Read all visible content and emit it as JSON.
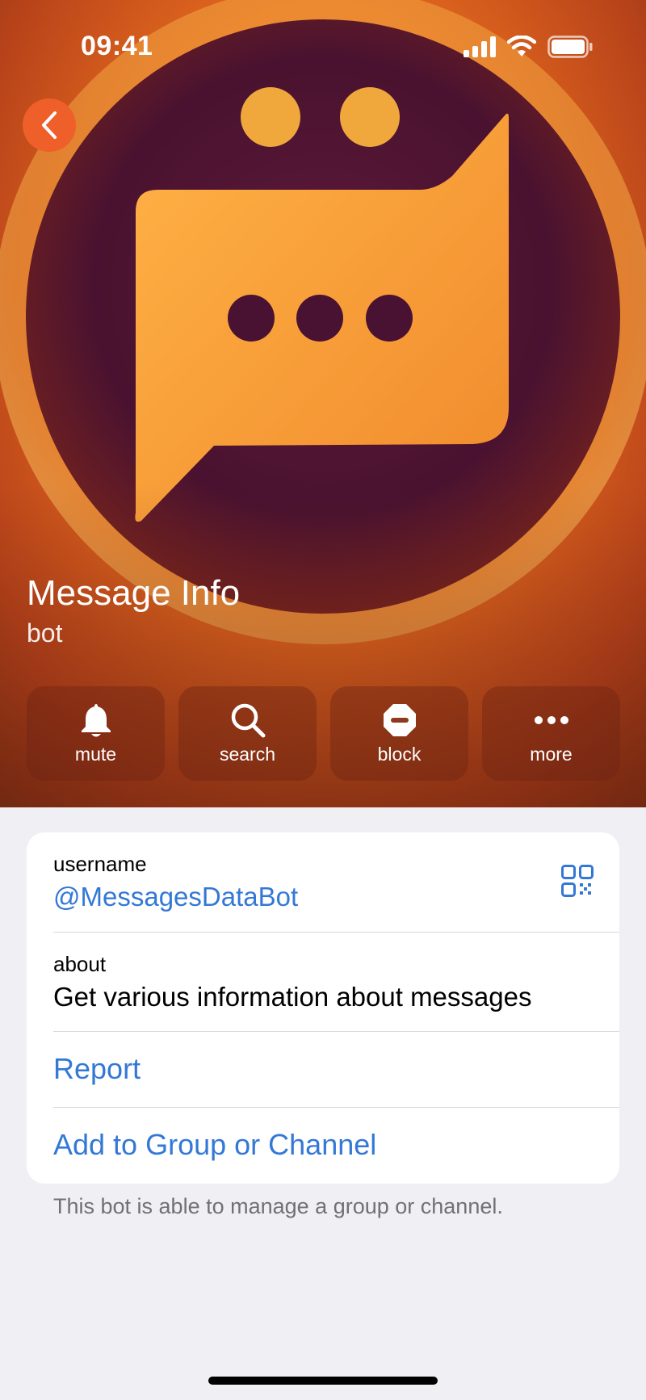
{
  "status_bar": {
    "time": "09:41"
  },
  "profile": {
    "name": "Message Info",
    "subtitle": "bot"
  },
  "actions": [
    {
      "id": "mute",
      "label": "mute",
      "icon": "bell-icon"
    },
    {
      "id": "search",
      "label": "search",
      "icon": "search-icon"
    },
    {
      "id": "block",
      "label": "block",
      "icon": "block-icon"
    },
    {
      "id": "more",
      "label": "more",
      "icon": "more-icon"
    }
  ],
  "info": {
    "username_label": "username",
    "username_value": "@MessagesDataBot",
    "about_label": "about",
    "about_value": "Get various information about messages",
    "report_label": "Report",
    "add_label": "Add to Group or Channel"
  },
  "footnote": "This bot is able to manage a group or channel.",
  "colors": {
    "link": "#3478d6",
    "back_button": "#ef5f2a",
    "background": "#efeff4"
  }
}
